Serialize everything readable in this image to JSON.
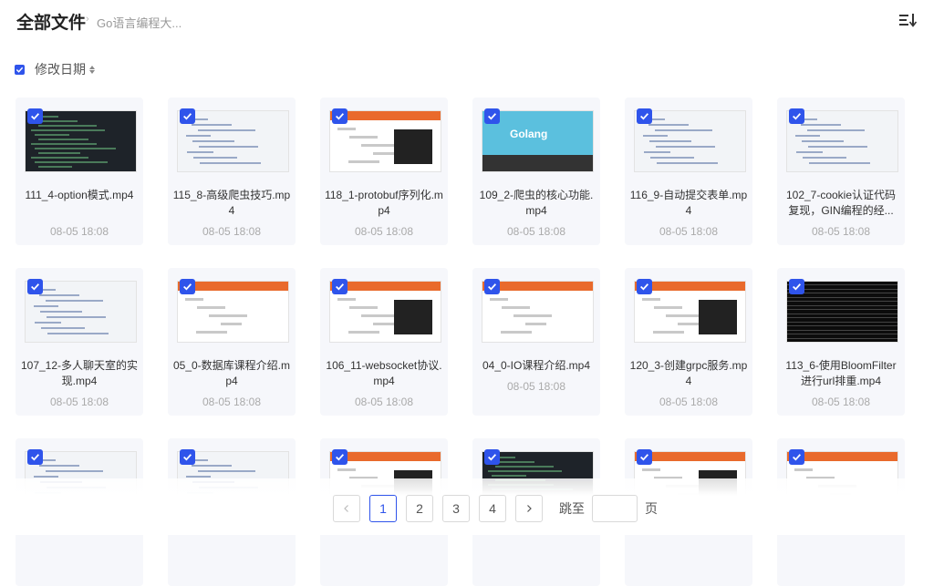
{
  "header": {
    "title": "全部文件",
    "separator": "›",
    "breadcrumb": "Go语言编程大...",
    "sort_icon": "sort-list-icon"
  },
  "sortbar": {
    "checked": true,
    "label": "修改日期"
  },
  "files": [
    {
      "name": "111_4-option模式.mp4",
      "date": "08-05 18:08",
      "checked": true,
      "thumb": "dark"
    },
    {
      "name": "115_8-高级爬虫技巧.mp4",
      "date": "08-05 18:08",
      "checked": true,
      "thumb": "ide"
    },
    {
      "name": "118_1-protobuf序列化.mp4",
      "date": "08-05 18:08",
      "checked": true,
      "thumb": "ppt"
    },
    {
      "name": "109_2-爬虫的核心功能.mp4",
      "date": "08-05 18:08",
      "checked": true,
      "thumb": "golang"
    },
    {
      "name": "116_9-自动提交表单.mp4",
      "date": "08-05 18:08",
      "checked": true,
      "thumb": "ide"
    },
    {
      "name": "102_7-cookie认证代码复现，GIN编程的经...",
      "date": "08-05 18:08",
      "checked": true,
      "thumb": "ide"
    },
    {
      "name": "107_12-多人聊天室的实现.mp4",
      "date": "08-05 18:08",
      "checked": true,
      "thumb": "ide"
    },
    {
      "name": "05_0-数据库课程介绍.mp4",
      "date": "08-05 18:08",
      "checked": true,
      "thumb": "ppt"
    },
    {
      "name": "106_11-websocket协议.mp4",
      "date": "08-05 18:08",
      "checked": true,
      "thumb": "ppt"
    },
    {
      "name": "04_0-IO课程介绍.mp4",
      "date": "08-05 18:08",
      "checked": true,
      "thumb": "ppt"
    },
    {
      "name": "120_3-创建grpc服务.mp4",
      "date": "08-05 18:08",
      "checked": true,
      "thumb": "ppt"
    },
    {
      "name": "113_6-使用BloomFilter进行url排重.mp4",
      "date": "08-05 18:08",
      "checked": true,
      "thumb": "black"
    },
    {
      "name": "",
      "date": "",
      "checked": true,
      "thumb": "ide"
    },
    {
      "name": "",
      "date": "",
      "checked": true,
      "thumb": "ide"
    },
    {
      "name": "",
      "date": "",
      "checked": true,
      "thumb": "ppt"
    },
    {
      "name": "",
      "date": "",
      "checked": true,
      "thumb": "dark"
    },
    {
      "name": "",
      "date": "",
      "checked": true,
      "thumb": "ppt"
    },
    {
      "name": "",
      "date": "",
      "checked": true,
      "thumb": "ppt"
    }
  ],
  "pagination": {
    "prev_icon": "chevron-left-icon",
    "pages": [
      "1",
      "2",
      "3",
      "4"
    ],
    "current": "1",
    "next_icon": "chevron-right-icon",
    "jump_label": "跳至",
    "jump_value": "",
    "suffix": "页"
  },
  "colors": {
    "accent": "#2f54eb",
    "card_bg": "#f6f7fb"
  }
}
